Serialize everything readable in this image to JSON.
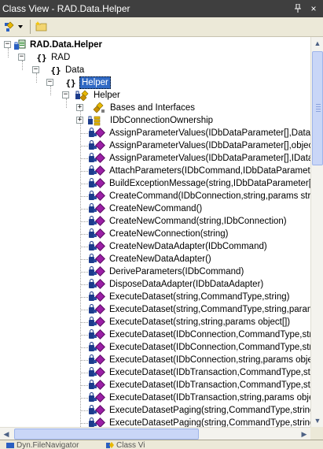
{
  "window": {
    "title": "Class View - RAD.Data.Helper",
    "pin_glyph": "ᛘ",
    "close_glyph": "×"
  },
  "toolbar": {
    "sort_icon": "sort-by-type-icon",
    "dropdown_icon": "chevron-down-icon",
    "new_folder_icon": "new-folder-icon"
  },
  "tree": {
    "project": "RAD.Data.Helper",
    "ns_rad": "RAD",
    "ns_data": "Data",
    "ns_helper": "Helper",
    "class_helper": "Helper",
    "bases": "Bases and Interfaces",
    "nested_enum": "IDbConnectionOwnership",
    "members": [
      "AssignParameterValues(IDbDataParameter[],DataRo",
      "AssignParameterValues(IDbDataParameter[],object[]",
      "AssignParameterValues(IDbDataParameter[],IDataPa",
      "AttachParameters(IDbCommand,IDbDataParameter[",
      "BuildExceptionMessage(string,IDbDataParameter[])",
      "CreateCommand(IDbConnection,string,params string",
      "CreateNewCommand()",
      "CreateNewCommand(string,IDbConnection)",
      "CreateNewConnection(string)",
      "CreateNewDataAdapter(IDbCommand)",
      "CreateNewDataAdapter()",
      "DeriveParameters(IDbCommand)",
      "DisposeDataAdapter(IDbDataAdapter)",
      "ExecuteDataset(string,CommandType,string)",
      "ExecuteDataset(string,CommandType,string,params",
      "ExecuteDataset(string,string,params object[])",
      "ExecuteDataset(IDbConnection,CommandType,string",
      "ExecuteDataset(IDbConnection,CommandType,strin",
      "ExecuteDataset(IDbConnection,string,params object",
      "ExecuteDataset(IDbTransaction,CommandType,string",
      "ExecuteDataset(IDbTransaction,CommandType,strin",
      "ExecuteDataset(IDbTransaction,string,params objec",
      "ExecuteDatasetPaging(string,CommandType,string,i",
      "ExecuteDatasetPaging(string,CommandType,string,in"
    ]
  },
  "bottom_tabs": {
    "tab1": "Dyn.FileNavigator",
    "tab2": "Class Vi"
  }
}
